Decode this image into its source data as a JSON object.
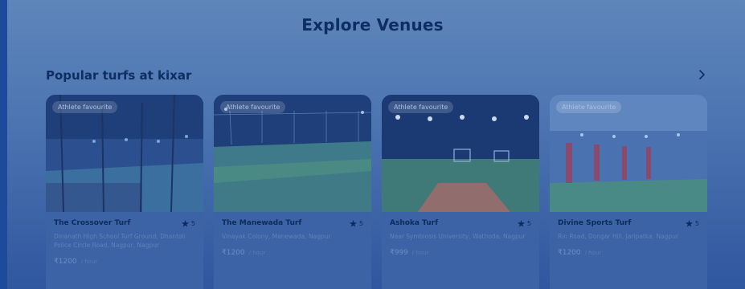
{
  "page": {
    "heading": "Explore Venues"
  },
  "section": {
    "title": "Popular turfs at kixar",
    "next_icon": "chevron-right-icon"
  },
  "colors": {
    "background": "#4f78b3",
    "heading": "#0e2e63",
    "strip": "#1d4a9a"
  },
  "cards": [
    {
      "badge": "Athlete favourite",
      "name": "The Crossover Turf",
      "rating": "5",
      "address": "Dinanath High School Turf Ground, Dhantoli Police Circle Road, Nagpur, Nagpur",
      "price": "₹1200",
      "unit": "/ hour"
    },
    {
      "badge": "Athlete favourite",
      "name": "The Manewada Turf",
      "rating": "5",
      "address": "Vinayak Colony, Manewada, Nagpur",
      "price": "₹1200",
      "unit": "/ hour"
    },
    {
      "badge": "Athlete favourite",
      "name": "Ashoka Turf",
      "rating": "5",
      "address": "Near Symbiosis University, Wathoda, Nagpur",
      "price": "₹999",
      "unit": "/ hour"
    },
    {
      "badge": "Athlete favourite",
      "name": "Divine Sports Turf",
      "rating": "5",
      "address": "Rin Road, Dongar Hill, Jaripatka, Nagpur",
      "price": "₹1200",
      "unit": "/ hour"
    }
  ]
}
